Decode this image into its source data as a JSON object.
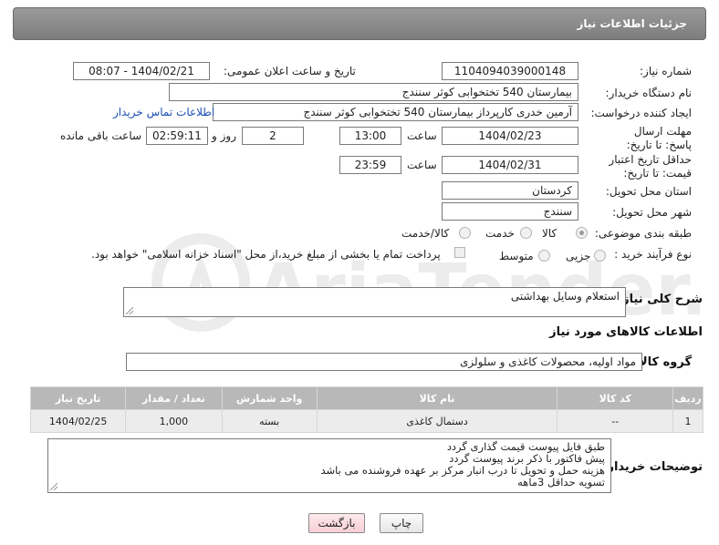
{
  "header": {
    "title": "جزئیات اطلاعات نیاز"
  },
  "form": {
    "need_number": {
      "label": "شماره نیاز:",
      "value": "1104094039000148"
    },
    "announce_datetime": {
      "label": "تاریخ و ساعت اعلان عمومی:",
      "value": "1404/02/21 - 08:07"
    },
    "buyer_org": {
      "label": "نام دستگاه خریدار:",
      "value": "بیمارستان 540 تختخوابی کوثر سنندج"
    },
    "requester": {
      "label": "ایجاد کننده درخواست:",
      "value": "آرمین خدری کارپرداز بیمارستان 540 تختخوابی کوثر سنندج",
      "contact_link": "اطلاعات تماس خریدار"
    },
    "deadline": {
      "label": "مهلت ارسال پاسخ: تا تاریخ:",
      "date": "1404/02/23",
      "time_label": "ساعت",
      "time": "13:00",
      "days": "2",
      "days_label": "روز و",
      "remaining": "02:59:11",
      "remaining_label": "ساعت باقی مانده"
    },
    "validity": {
      "label": "حداقل تاریخ اعتبار قیمت: تا تاریخ:",
      "date": "1404/02/31",
      "time_label": "ساعت",
      "time": "23:59"
    },
    "province": {
      "label": "استان محل تحویل:",
      "value": "کردستان"
    },
    "city": {
      "label": "شهر محل تحویل:",
      "value": "سنندج"
    },
    "category": {
      "label": "طبقه بندی موضوعی:",
      "options": [
        "کالا",
        "خدمت",
        "کالا/خدمت"
      ]
    },
    "process": {
      "label": "نوع فرآیند خرید :",
      "options": [
        "جزیی",
        "متوسط"
      ],
      "payment_note": "پرداخت تمام یا بخشی از مبلغ خرید،از محل \"اسناد خزانه اسلامی\" خواهد بود."
    }
  },
  "description": {
    "label": "شرح کلی نیاز:",
    "value": "استعلام وسایل بهداشتی"
  },
  "goods": {
    "title": "اطلاعات کالاهای مورد نیاز",
    "group_label": "گروه کالا:",
    "group_value": "مواد اولیه، محصولات کاغذی و سلولزی",
    "columns": [
      "ردیف",
      "کد کالا",
      "نام کالا",
      "واحد شمارش",
      "تعداد / مقدار",
      "تاریخ نیاز"
    ],
    "rows": [
      {
        "row": "1",
        "code": "--",
        "name": "دستمال کاغذی",
        "unit": "بسته",
        "qty": "1,000",
        "date": "1404/02/25"
      }
    ]
  },
  "buyer_notes": {
    "label": "توضیحات خریدار:",
    "lines": [
      "طبق فایل پیوست قیمت گذاری گردد",
      "پیش فاکتور با ذکر برند پیوست گردد",
      "هزینه حمل و تحویل تا درب انبار مرکز بر عهده فروشنده می باشد",
      "تسویه حداقل 3ماهه"
    ]
  },
  "buttons": {
    "print": "چاپ",
    "back": "بازگشت"
  },
  "colors": {
    "panel": "#8c8c8c",
    "table_header": "#b8b8b8",
    "link": "#1a4fb5",
    "back_button": "#f7cfd6"
  }
}
